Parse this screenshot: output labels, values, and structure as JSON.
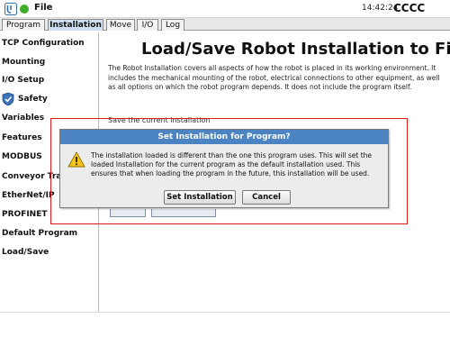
{
  "header": {
    "file_label": "File",
    "clock": "14:42:24",
    "robot_name": "CCCC",
    "status_color": "#3fae2a"
  },
  "tabs": [
    {
      "label": "Program",
      "active": false
    },
    {
      "label": "Installation",
      "active": true
    },
    {
      "label": "Move",
      "active": false
    },
    {
      "label": "I/O",
      "active": false
    },
    {
      "label": "Log",
      "active": false
    }
  ],
  "sidebar": {
    "items": [
      {
        "label": "TCP Configuration"
      },
      {
        "label": "Mounting"
      },
      {
        "label": "I/O Setup"
      },
      {
        "label": "Safety",
        "icon": "shield-icon"
      },
      {
        "label": "Variables"
      },
      {
        "label": "Features"
      },
      {
        "label": "MODBUS"
      },
      {
        "label": "Conveyor Tracking"
      },
      {
        "label": "EtherNet/IP"
      },
      {
        "label": "PROFINET"
      },
      {
        "label": "Default Program"
      },
      {
        "label": "Load/Save"
      }
    ]
  },
  "main": {
    "title": "Load/Save Robot Installation to File",
    "description": "The Robot Installation covers all aspects of how the robot is placed in its working environment. It includes the mechanical mounting of the robot, electrical connections to other equipment, as well as all options on which the robot program depends. It does not include the program itself.",
    "save_label": "Save the current installation"
  },
  "dialog": {
    "title": "Set Installation for Program?",
    "icon": "warning-icon",
    "message": "The installation loaded is different than the one this program uses. This will set the loaded Installation for the current program as the default installation used. This ensures that when loading the program in the future, this installation will be used.",
    "confirm_label": "Set Installation",
    "cancel_label": "Cancel",
    "title_color": "#4b83c3"
  },
  "highlight_color": "#dd1b1b"
}
